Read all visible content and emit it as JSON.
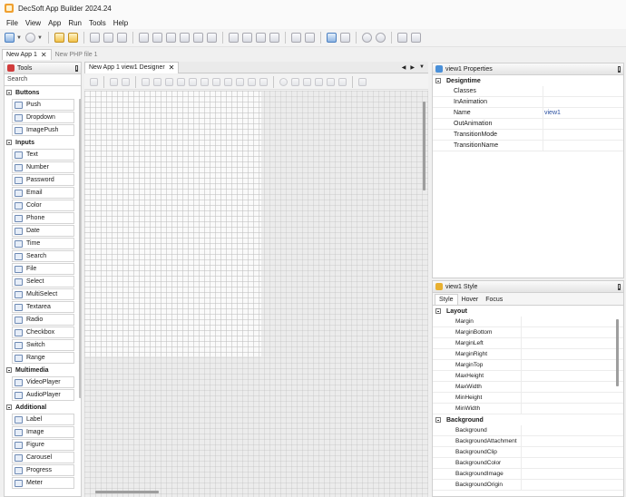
{
  "window": {
    "title": "DecSoft App Builder 2024.24"
  },
  "menu": [
    "File",
    "View",
    "App",
    "Run",
    "Tools",
    "Help"
  ],
  "doc_tabs": [
    {
      "label": "New App 1",
      "active": true
    },
    {
      "label": "New PHP file 1",
      "active": false
    }
  ],
  "tools": {
    "title": "Tools",
    "search_placeholder": "Search",
    "categories": [
      {
        "name": "Buttons",
        "items": [
          "Push",
          "Dropdown",
          "ImagePush"
        ]
      },
      {
        "name": "Inputs",
        "items": [
          "Text",
          "Number",
          "Password",
          "Email",
          "Color",
          "Phone",
          "Date",
          "Time",
          "Search",
          "File",
          "Select",
          "MultiSelect",
          "Textarea",
          "Radio",
          "Checkbox",
          "Switch",
          "Range"
        ]
      },
      {
        "name": "Multimedia",
        "items": [
          "VideoPlayer",
          "AudioPlayer"
        ]
      },
      {
        "name": "Additional",
        "items": [
          "Label",
          "Image",
          "Figure",
          "Carousel",
          "Progress",
          "Meter"
        ]
      }
    ]
  },
  "designer": {
    "tab_label": "New App 1 view1 Designer"
  },
  "properties": {
    "title": "view1 Properties",
    "section": "Designtime",
    "rows": [
      {
        "name": "Classes",
        "value": ""
      },
      {
        "name": "InAnimation",
        "value": ""
      },
      {
        "name": "Name",
        "value": "view1"
      },
      {
        "name": "OutAnimation",
        "value": ""
      },
      {
        "name": "TransitionMode",
        "value": ""
      },
      {
        "name": "TransitionName",
        "value": ""
      }
    ]
  },
  "style": {
    "title": "view1 Style",
    "tabs": [
      "Style",
      "Hover",
      "Focus"
    ],
    "sections": [
      {
        "name": "Layout",
        "rows": [
          "Margin",
          "MarginBottom",
          "MarginLeft",
          "MarginRight",
          "MarginTop",
          "MaxHeight",
          "MaxWidth",
          "MinHeight",
          "MinWidth"
        ]
      },
      {
        "name": "Background",
        "rows": [
          "Background",
          "BackgroundAttachment",
          "BackgroundClip",
          "BackgroundColor",
          "BackgroundImage",
          "BackgroundOrigin"
        ]
      }
    ]
  }
}
